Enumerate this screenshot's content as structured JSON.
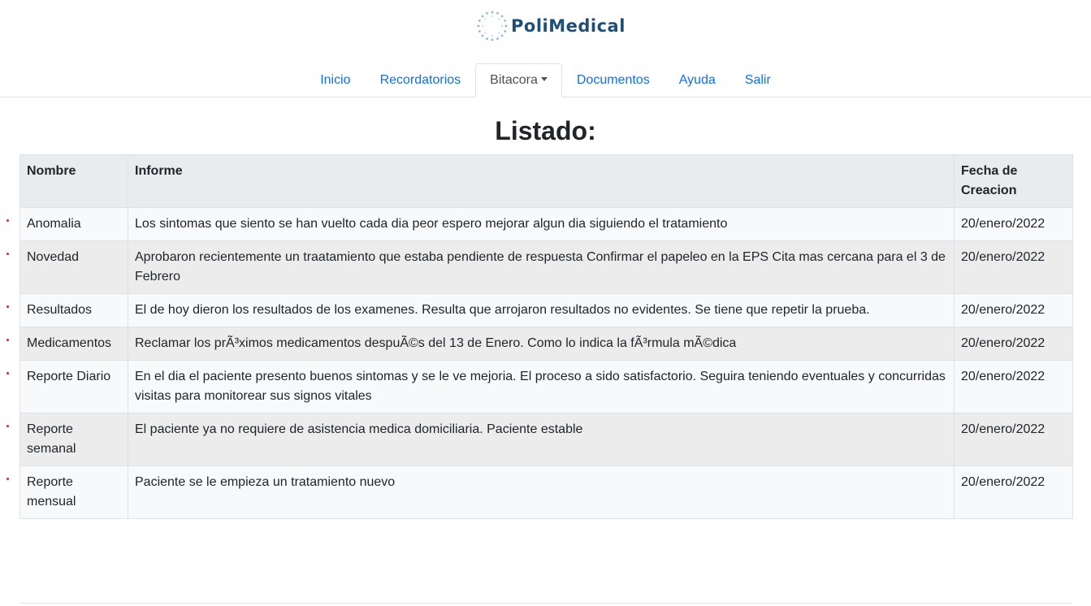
{
  "brand": {
    "name": "PoliMedical",
    "color": "#1f4e79"
  },
  "nav": {
    "items": [
      {
        "label": "Inicio"
      },
      {
        "label": "Recordatorios"
      },
      {
        "label": "Bitacora"
      },
      {
        "label": "Documentos"
      },
      {
        "label": "Ayuda"
      },
      {
        "label": "Salir"
      }
    ],
    "active": "Bitacora"
  },
  "page": {
    "title": "Listado:"
  },
  "table": {
    "headers": [
      "Nombre",
      "Informe",
      "Fecha de Creacion"
    ],
    "rows": [
      {
        "nombre": "Anomalia",
        "informe": "Los sintomas que siento se han vuelto cada dia peor espero mejorar algun dia siguiendo el tratamiento",
        "fecha": "20/enero/2022"
      },
      {
        "nombre": "Novedad",
        "informe": "Aprobaron recientemente un traatamiento que estaba pendiente de respuesta Confirmar el papeleo en la EPS Cita mas cercana para el 3 de Febrero",
        "fecha": "20/enero/2022"
      },
      {
        "nombre": "Resultados",
        "informe": "El de hoy dieron los resultados de los examenes. Resulta que arrojaron resultados no evidentes. Se tiene que repetir la prueba.",
        "fecha": "20/enero/2022"
      },
      {
        "nombre": "Medicamentos",
        "informe": "Reclamar los prÃ³ximos medicamentos despuÃ©s del 13 de Enero. Como lo indica la fÃ³rmula mÃ©dica",
        "fecha": "20/enero/2022"
      },
      {
        "nombre": "Reporte Diario",
        "informe": "En el dia el paciente presento buenos sintomas y se le ve mejoria. El proceso a sido satisfactorio. Seguira teniendo eventuales y concurridas visitas para monitorear sus signos vitales",
        "fecha": "20/enero/2022"
      },
      {
        "nombre": "Reporte semanal",
        "informe": "El paciente ya no requiere de asistencia medica domiciliaria. Paciente estable",
        "fecha": "20/enero/2022"
      },
      {
        "nombre": "Reporte mensual",
        "informe": "Paciente se le empieza un tratamiento nuevo",
        "fecha": "20/enero/2022"
      }
    ]
  },
  "colors": {
    "link": "#0d6efd",
    "header_bg": "#e9ecef",
    "row_odd": "#f8f9fa",
    "row_even": "#ececed",
    "bullet": "#d62a2a"
  },
  "icons": {
    "logo": "dotted-circle-logo-icon",
    "dropdown": "caret-down-icon",
    "row_marker": "bullet-icon"
  }
}
